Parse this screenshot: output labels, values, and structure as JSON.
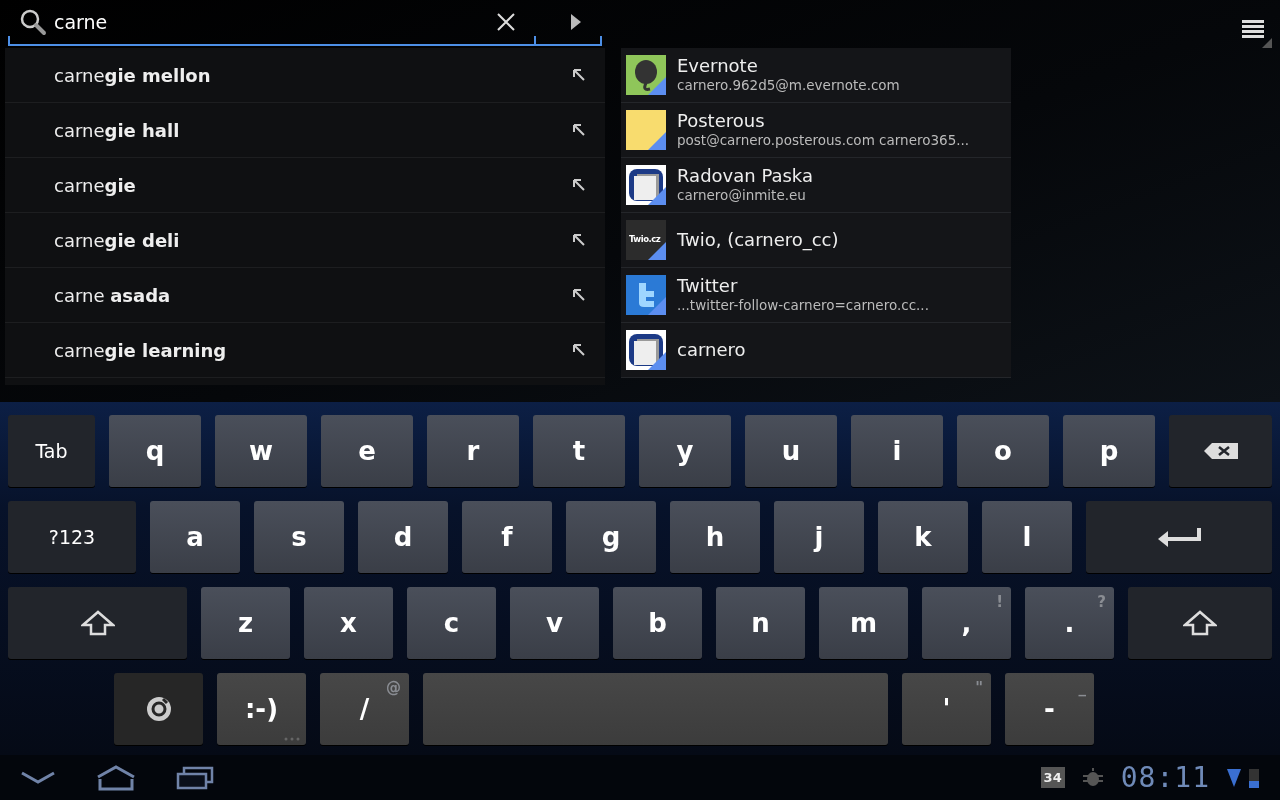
{
  "search": {
    "value": "carne"
  },
  "suggestions": [
    {
      "text": "carne**gie mellon**"
    },
    {
      "text": "carne**gie hall**"
    },
    {
      "text": "carne**gie**"
    },
    {
      "text": "carne**gie deli**"
    },
    {
      "text": "carne **asada**"
    },
    {
      "text": "carne**gie learning**"
    }
  ],
  "contacts": [
    {
      "name": "Evernote",
      "detail": "carnero.962d5@m.evernote.com",
      "kind": "elephant"
    },
    {
      "name": "Posterous",
      "detail": "post@carnero.posterous.com carnero365...",
      "kind": "note"
    },
    {
      "name": "Radovan Paska",
      "detail": "carnero@inmite.eu",
      "kind": "app"
    },
    {
      "name": "Twio, (carnero_cc)",
      "kind": "twio",
      "logo": "Twio.cz"
    },
    {
      "name": "Twitter",
      "detail": "...twitter-follow-carnero=carnero.cc...",
      "kind": "bird"
    },
    {
      "name": "carnero",
      "kind": "app"
    }
  ],
  "keyboard": {
    "rows": [
      [
        {
          "kind": "function",
          "label": "Tab"
        },
        {
          "kind": "text",
          "label": "q"
        },
        {
          "kind": "text",
          "label": "w"
        },
        {
          "kind": "text",
          "label": "e"
        },
        {
          "kind": "text",
          "label": "r"
        },
        {
          "kind": "text",
          "label": "t"
        },
        {
          "kind": "text",
          "label": "y"
        },
        {
          "kind": "text",
          "label": "u"
        },
        {
          "kind": "text",
          "label": "i"
        },
        {
          "kind": "text",
          "label": "o"
        },
        {
          "kind": "text",
          "label": "p"
        },
        {
          "kind": "backspace"
        }
      ],
      [
        {
          "kind": "function",
          "label": "?123"
        },
        {
          "kind": "text",
          "label": "a"
        },
        {
          "kind": "text",
          "label": "s"
        },
        {
          "kind": "text",
          "label": "d"
        },
        {
          "kind": "text",
          "label": "f"
        },
        {
          "kind": "text",
          "label": "g"
        },
        {
          "kind": "text",
          "label": "h"
        },
        {
          "kind": "text",
          "label": "j"
        },
        {
          "kind": "text",
          "label": "k"
        },
        {
          "kind": "text",
          "label": "l"
        },
        {
          "kind": "enter"
        }
      ],
      [
        {
          "kind": "shift"
        },
        {
          "kind": "text",
          "label": "z"
        },
        {
          "kind": "text",
          "label": "x"
        },
        {
          "kind": "text",
          "label": "c"
        },
        {
          "kind": "text",
          "label": "v"
        },
        {
          "kind": "text",
          "label": "b"
        },
        {
          "kind": "text",
          "label": "n"
        },
        {
          "kind": "text",
          "label": "m"
        },
        {
          "kind": "text",
          "label": ",",
          "hint": "!"
        },
        {
          "kind": "text",
          "label": ".",
          "hint": "?"
        },
        {
          "kind": "shift"
        }
      ],
      [
        {
          "kind": "settings"
        },
        {
          "kind": "text",
          "label": ":-)",
          "more": true
        },
        {
          "kind": "text",
          "label": "/",
          "hint": "@"
        },
        {
          "kind": "space"
        },
        {
          "kind": "text",
          "label": "'",
          "hint": "\""
        },
        {
          "kind": "text",
          "label": "-",
          "hint": "_"
        }
      ]
    ]
  },
  "status_bar": {
    "notification_count": "34",
    "time": "08:11"
  }
}
